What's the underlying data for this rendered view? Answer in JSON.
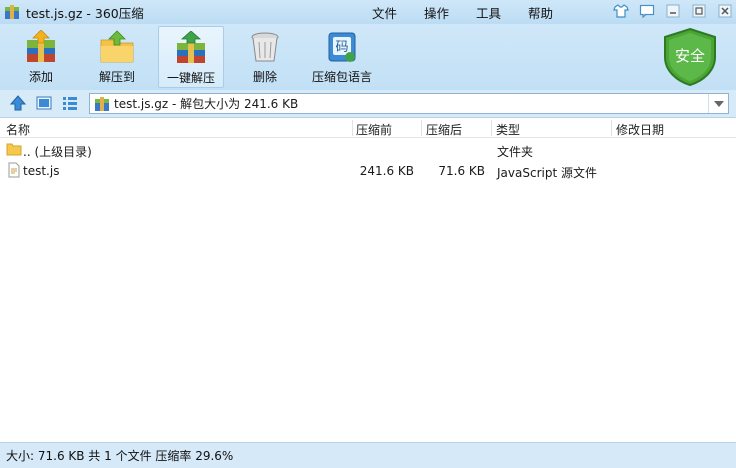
{
  "window": {
    "title": "test.js.gz - 360压缩",
    "menu": [
      "文件",
      "操作",
      "工具",
      "帮助"
    ]
  },
  "toolbar": {
    "items": [
      {
        "label": "添加",
        "icon": "add-archive-icon"
      },
      {
        "label": "解压到",
        "icon": "extract-to-icon"
      },
      {
        "label": "一键解压",
        "icon": "one-click-extract-icon"
      },
      {
        "label": "删除",
        "icon": "trash-icon"
      },
      {
        "label": "压缩包语言",
        "icon": "archive-language-icon",
        "badge": "码"
      }
    ],
    "security_badge": "安全"
  },
  "navbar": {
    "path": "test.js.gz - 解包大小为 241.6 KB"
  },
  "columns": [
    "名称",
    "压缩前",
    "压缩后",
    "类型",
    "修改日期"
  ],
  "rows": [
    {
      "name": ".. (上级目录)",
      "size": "",
      "packed": "",
      "type": "文件夹",
      "modified": "",
      "icon": "folder-icon"
    },
    {
      "name": "test.js",
      "size": "241.6 KB",
      "packed": "71.6 KB",
      "type": "JavaScript 源文件",
      "modified": "",
      "icon": "js-file-icon"
    }
  ],
  "status": "大小: 71.6 KB 共 1 个文件 压缩率 29.6%",
  "colors": {
    "chrome_bg": "#cfe7f9",
    "security_green": "#3f9b2f",
    "selected_tool_bg": "#e4f2fc"
  }
}
